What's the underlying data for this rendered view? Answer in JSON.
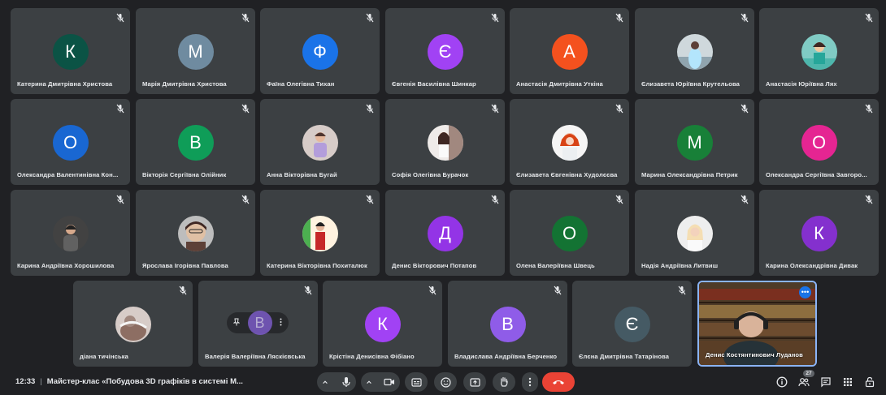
{
  "participants": {
    "row1": [
      {
        "name": "Катерина Дмитрівна Христова",
        "initial": "К",
        "color": "#0b5345",
        "photo": false
      },
      {
        "name": "Марія Дмитрівна Христова",
        "initial": "М",
        "color": "#6f8ba0",
        "photo": false
      },
      {
        "name": "Фаїна Олегівна Тихан",
        "initial": "Ф",
        "color": "#1a73e8",
        "photo": false
      },
      {
        "name": "Євгенія Василівна Шинкар",
        "initial": "Є",
        "color": "#a142f4",
        "photo": false
      },
      {
        "name": "Анастасія Дмитрівна Уткіна",
        "initial": "А",
        "color": "#f4511e",
        "photo": false
      },
      {
        "name": "Єлизавета Юріївна Крутельова",
        "initial": "",
        "color": "",
        "photo": true
      },
      {
        "name": "Анастасія Юріївна Лях",
        "initial": "",
        "color": "",
        "photo": true
      }
    ],
    "row2": [
      {
        "name": "Олександра Валентинівна Кон...",
        "initial": "О",
        "color": "#1967d2",
        "photo": false
      },
      {
        "name": "Вікторія Сергіївна Олійник",
        "initial": "В",
        "color": "#0f9d58",
        "photo": false
      },
      {
        "name": "Анна Вікторівна Бугай",
        "initial": "",
        "color": "",
        "photo": true
      },
      {
        "name": "Софія Олегівна Бурачок",
        "initial": "",
        "color": "",
        "photo": true
      },
      {
        "name": "Єлизавета Євгенівна Худолєєва",
        "initial": "",
        "color": "",
        "photo": true
      },
      {
        "name": "Марина Олександрівна Петрик",
        "initial": "М",
        "color": "#188038",
        "photo": false
      },
      {
        "name": "Олександра Сергіївна Завгоро...",
        "initial": "О",
        "color": "#e52592",
        "photo": false
      }
    ],
    "row3": [
      {
        "name": "Карина Андріївна Хорошилова",
        "initial": "",
        "color": "",
        "photo": true
      },
      {
        "name": "Ярослава Ігорівна Павлова",
        "initial": "",
        "color": "",
        "photo": true
      },
      {
        "name": "Катерина Вікторівна Похиталюк",
        "initial": "",
        "color": "",
        "photo": true
      },
      {
        "name": "Денис Вікторович Потапов",
        "initial": "Д",
        "color": "#9334e6",
        "photo": false
      },
      {
        "name": "Олена Валеріївна Швець",
        "initial": "О",
        "color": "#137333",
        "photo": false
      },
      {
        "name": "Надія Андріївна Литвиш",
        "initial": "",
        "color": "",
        "photo": true
      },
      {
        "name": "Карина Олександрівна Дивак",
        "initial": "К",
        "color": "#8430ce",
        "photo": false
      }
    ],
    "row4": [
      {
        "name": "діана тичінська",
        "initial": "",
        "color": "",
        "photo": true
      },
      {
        "name": "Валерія Валеріївна Ляскієвська",
        "initial": "В",
        "color": "#7b5bc7",
        "photo": false,
        "hover": true
      },
      {
        "name": "Крістіна Денисівна Фібіано",
        "initial": "К",
        "color": "#a142f4",
        "photo": false
      },
      {
        "name": "Владислава Андріївна Берченко",
        "initial": "В",
        "color": "#8f5ce8",
        "photo": false
      },
      {
        "name": "Єлєна Дмитрівна Татарінова",
        "initial": "Є",
        "color": "#455a64",
        "photo": false
      },
      {
        "name": "Денис Костянтинович Луданов",
        "initial": "",
        "color": "",
        "photo": false,
        "video": true
      }
    ]
  },
  "toolbar": {
    "time": "12:33",
    "meeting_title": "Майстер-клас «Побудова 3D графіків в системі М...",
    "participant_count": "27"
  },
  "colors": {
    "background": "#202124",
    "tile": "#3c4043",
    "end_call": "#ea4335",
    "active_border": "#8ab4f8"
  },
  "icons": {
    "tile": "mic-off-icon",
    "controls": [
      "chevron-up-icon",
      "mic-icon",
      "chevron-up-icon",
      "camera-icon",
      "captions-icon",
      "emoji-icon",
      "present-icon",
      "raise-hand-icon",
      "more-vert-icon",
      "call-end-icon"
    ],
    "right": [
      "info-icon",
      "people-icon",
      "chat-icon",
      "activities-icon",
      "host-controls-icon"
    ]
  }
}
